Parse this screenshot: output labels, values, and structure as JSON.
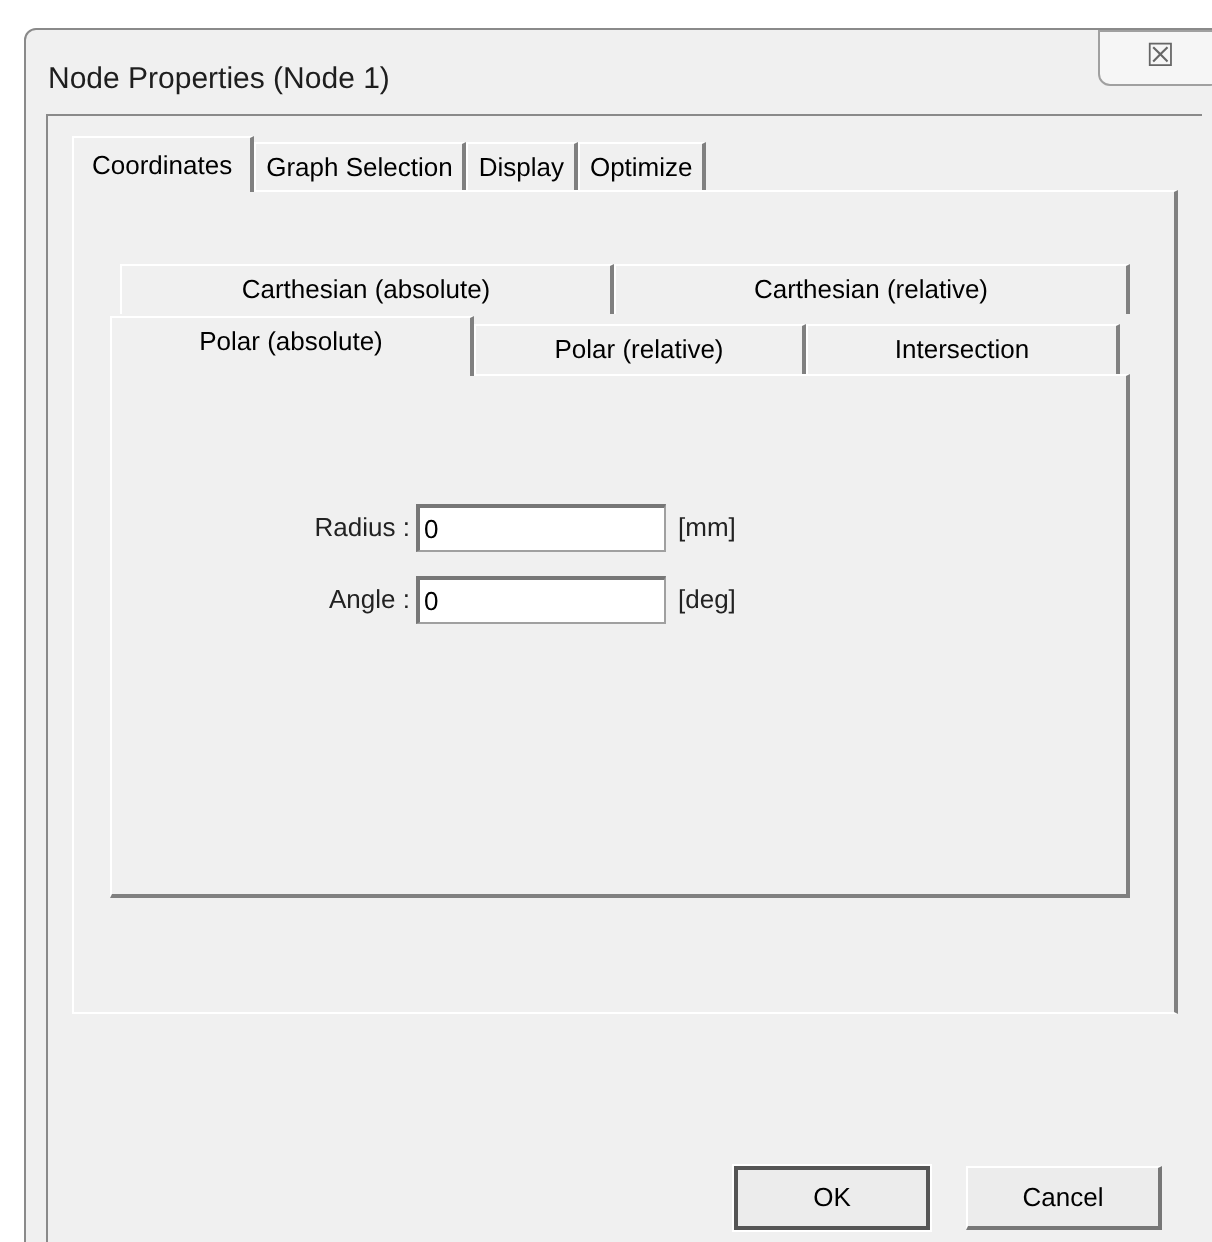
{
  "window": {
    "title": "Node Properties (Node 1)",
    "close": "☒"
  },
  "tabs": [
    {
      "label": "Coordinates",
      "selected": true
    },
    {
      "label": "Graph Selection",
      "selected": false
    },
    {
      "label": "Display",
      "selected": false
    },
    {
      "label": "Optimize",
      "selected": false
    }
  ],
  "subtab_rows": [
    [
      {
        "label": "Carthesian (absolute)",
        "selected": false
      },
      {
        "label": "Carthesian (relative)",
        "selected": false
      }
    ],
    [
      {
        "label": "Polar (absolute)",
        "selected": true
      },
      {
        "label": "Polar (relative)",
        "selected": false
      },
      {
        "label": "Intersection",
        "selected": false
      }
    ]
  ],
  "fields": [
    {
      "label": "Radius :",
      "value": "0",
      "unit": "[mm]"
    },
    {
      "label": "Angle :",
      "value": "0",
      "unit": "[deg]"
    }
  ],
  "buttons": [
    "OK",
    "Cancel"
  ]
}
